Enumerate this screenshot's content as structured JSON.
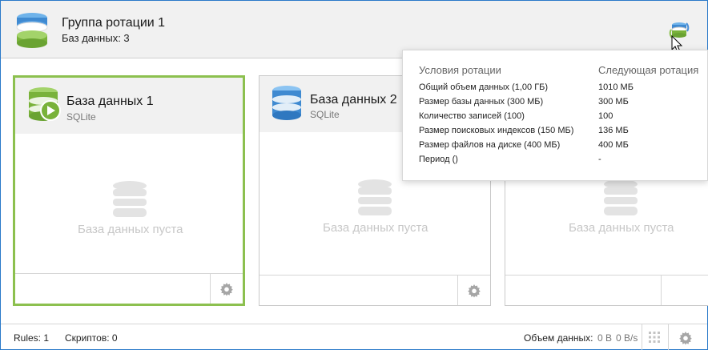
{
  "header": {
    "title": "Группа ротации 1",
    "subtitle": "Баз данных: 3",
    "icon": "database-stack-icon",
    "rotate_icon": "rotate-database-icon"
  },
  "cards": [
    {
      "title": "База данных 1",
      "engine": "SQLite",
      "empty_text": "База данных пуста",
      "selected": true,
      "status_icon": "play-icon",
      "color": "#8cc04f"
    },
    {
      "title": "База данных 2",
      "engine": "SQLite",
      "empty_text": "База данных пуста",
      "selected": false,
      "color": "#4a90d9"
    },
    {
      "title": "",
      "engine": "",
      "empty_text": "База данных пуста",
      "selected": false
    }
  ],
  "tooltip": {
    "col1_header": "Условия ротации",
    "col2_header": "Следующая ротация",
    "rows": [
      {
        "condition": "Общий объем данных (1,00 ГБ)",
        "next": "1010 МБ"
      },
      {
        "condition": "Размер базы данных (300 МБ)",
        "next": "300 МБ"
      },
      {
        "condition": "Количество записей (100)",
        "next": "100"
      },
      {
        "condition": "Размер поисковых индексов (150 МБ)",
        "next": "136 МБ"
      },
      {
        "condition": "Размер файлов на диске (400 МБ)",
        "next": "400 МБ"
      },
      {
        "condition": "Период ()",
        "next": "-"
      }
    ]
  },
  "statusbar": {
    "rules": "Rules: 1",
    "scripts": "Скриптов: 0",
    "data_volume_label": "Объем данных:",
    "data_volume_value": "0 B",
    "data_rate": "0 B/s"
  },
  "colors": {
    "accent_green": "#8cc04f",
    "accent_blue": "#4a90d9",
    "window_border": "#2a79c9"
  }
}
